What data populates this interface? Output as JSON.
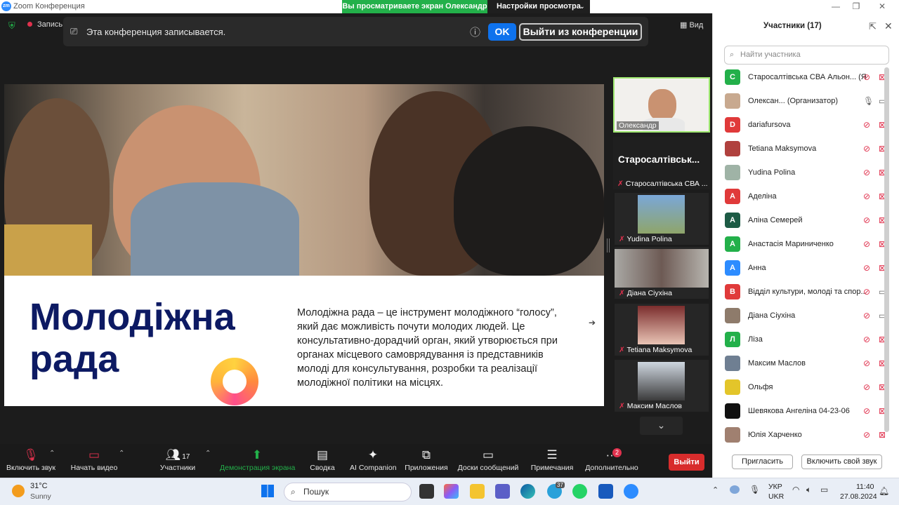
{
  "window": {
    "title": "Zoom Конференция",
    "logo": "zm",
    "share_banner": "Вы просматриваете экран Олександр",
    "view_settings": "Настройки просмотра"
  },
  "top_controls": {
    "recording": "Запись",
    "view": "Вид"
  },
  "recording_notice": {
    "text": "Эта конференция записывается.",
    "ok_label": "OK",
    "leave_label": "Выйти из конференции"
  },
  "slide": {
    "title_line1": "Молодіжна",
    "title_line2": "рада",
    "body": "Молодіжна рада – це інструмент молодіжного “голосу”, який дає можливість почути молодих людей. Це консультативно-дорадчий орган, який утворюється при органах місцевого самоврядування із представників молоді для консультування, розробки та реалізації молодіжної політики на місцях."
  },
  "thumbnails": {
    "self_name": "Олександр",
    "active_name": "Старосалтівськ...",
    "tiles": [
      {
        "label": "Старосалтівська СВА ..."
      },
      {
        "label": "Yudina Polina"
      },
      {
        "label": "Діана Сіухіна"
      },
      {
        "label": "Tetiana Maksymova"
      },
      {
        "label": "Максим Маслов"
      }
    ]
  },
  "toolbar": {
    "mute_label": "Включить звук",
    "video_label": "Начать видео",
    "participants_label": "Участники",
    "participants_count": "17",
    "share_label": "Демонстрация экрана",
    "summary_label": "Сводка",
    "ai_label": "AI Companion",
    "apps_label": "Приложения",
    "boards_label": "Доски сообщений",
    "notes_label": "Примечания",
    "more_label": "Дополнительно",
    "more_badge": "2",
    "exit_label": "Выйти"
  },
  "panel": {
    "title": "Участники (17)",
    "search_placeholder": "Найти участника",
    "invite_label": "Пригласить",
    "unmute_all_label": "Включить свой звук",
    "participants": [
      {
        "name": "Старосалтівська СВА Альон... (Я)",
        "avatar": "С",
        "color": "#23b04a",
        "mic": "muted",
        "video": "off"
      },
      {
        "name": "Олексан... (Организатор)",
        "avatar": "",
        "color": "#c8a98f",
        "mic": "on",
        "video": "on"
      },
      {
        "name": "dariafursova",
        "avatar": "D",
        "color": "#e03a3a",
        "mic": "muted",
        "video": "off"
      },
      {
        "name": "Tetiana Maksymova",
        "avatar": "",
        "color": "#b0413e",
        "mic": "muted",
        "video": "off"
      },
      {
        "name": "Yudina Polina",
        "avatar": "",
        "color": "#9fb3a6",
        "mic": "muted",
        "video": "off"
      },
      {
        "name": "Аделіна",
        "avatar": "А",
        "color": "#e03a3a",
        "mic": "muted",
        "video": "off"
      },
      {
        "name": "Аліна Семерей",
        "avatar": "A",
        "color": "#1d5b45",
        "mic": "muted",
        "video": "off"
      },
      {
        "name": "Анастасія Мариниченко",
        "avatar": "А",
        "color": "#23b04a",
        "mic": "muted",
        "video": "off"
      },
      {
        "name": "Анна",
        "avatar": "А",
        "color": "#2d8cff",
        "mic": "muted",
        "video": "off"
      },
      {
        "name": "Відділ культури, молоді та спор...",
        "avatar": "В",
        "color": "#e03a3a",
        "mic": "muted",
        "video": "on"
      },
      {
        "name": "Діана Сіухіна",
        "avatar": "",
        "color": "#8e7b6b",
        "mic": "muted",
        "video": "on"
      },
      {
        "name": "Ліза",
        "avatar": "Л",
        "color": "#23b04a",
        "mic": "muted",
        "video": "off"
      },
      {
        "name": "Максим Маслов",
        "avatar": "",
        "color": "#6f7f92",
        "mic": "muted",
        "video": "off"
      },
      {
        "name": "Ольфя",
        "avatar": "",
        "color": "#e3c52a",
        "mic": "muted",
        "video": "off"
      },
      {
        "name": "Шевякова Ангеліна 04-23-06",
        "avatar": "",
        "color": "#111111",
        "mic": "muted",
        "video": "off"
      },
      {
        "name": "Юлія Харченко",
        "avatar": "",
        "color": "#a08070",
        "mic": "muted",
        "video": "off"
      }
    ]
  },
  "taskbar": {
    "weather_temp": "31°C",
    "weather_desc": "Sunny",
    "search_label": "Пошук",
    "lang_top": "УКР",
    "lang_bottom": "UKR",
    "time": "11:40",
    "date": "27.08.2024",
    "telegram_badge": "37"
  }
}
